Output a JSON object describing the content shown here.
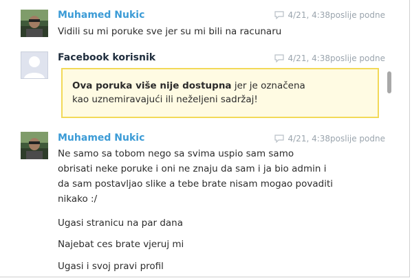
{
  "messages": [
    {
      "sender": "Muhamed Nukic",
      "timestamp": "4/21, 4:38poslije podne",
      "lines": [
        "Vidili su mi poruke sve jer su mi bili na racunaru"
      ]
    },
    {
      "sender": "Facebook korisnik",
      "timestamp": "4/21, 4:38poslije podne",
      "notice": {
        "bold": "Ova poruka više nije dostupna",
        "rest_line1": " jer je označena",
        "line2": "kao uznemiravajući ili neželjeni sadržaj!"
      }
    },
    {
      "sender": "Muhamed Nukic",
      "timestamp": "4/21, 4:38poslije podne",
      "lines": [
        "Ne samo sa tobom nego sa svima uspio sam samo",
        "obrisati neke poruke i oni ne znaju da sam i ja bio admin i",
        "da sam postavljao slike a tebe brate nisam mogao povaditi",
        "nikako :/",
        "Ugasi stranicu na par dana",
        "Najebat ces brate vjeruj mi",
        "Ugasi i svoj pravi profil"
      ]
    }
  ],
  "icons": {
    "timestamp": "chat-bubble-icon",
    "avatar_placeholder": "facebook-default-avatar-icon"
  },
  "colors": {
    "user_name": "#3b9bd6",
    "timestamp": "#9aa4ad",
    "notice_bg": "#fffbe3",
    "notice_border": "#f2d957"
  }
}
